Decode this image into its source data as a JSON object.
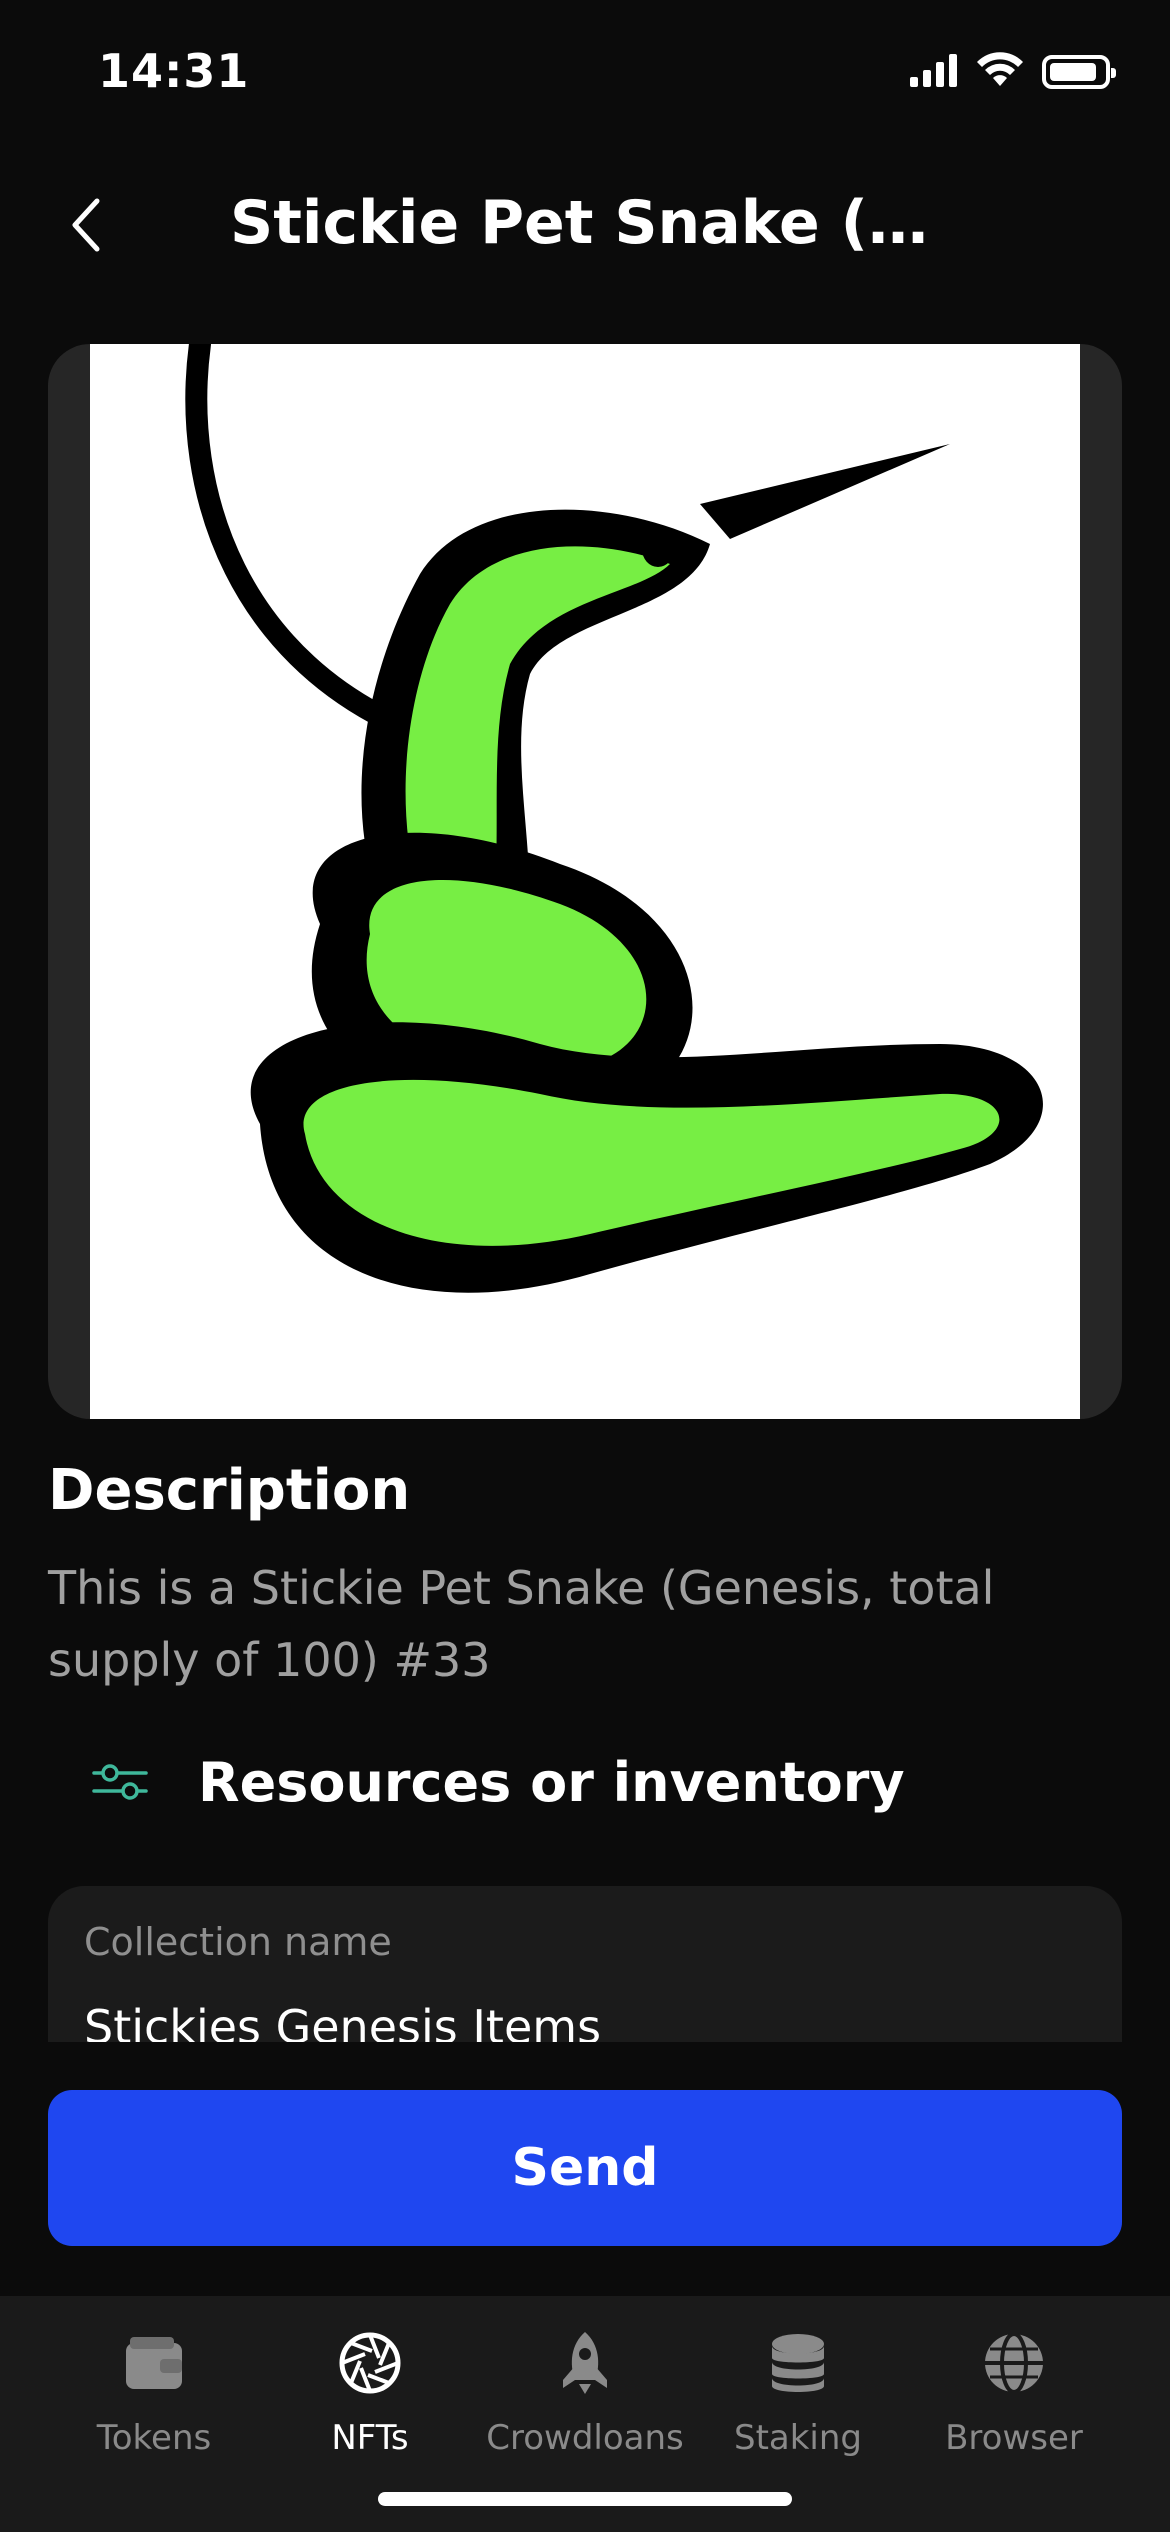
{
  "status_bar": {
    "time": "14:31",
    "icons": [
      "signal-icon",
      "wifi-icon",
      "battery-icon"
    ]
  },
  "header": {
    "title": "Stickie Pet Snake (Gen…",
    "back_icon": "chevron-left-icon"
  },
  "nft": {
    "image": "snake-artwork",
    "colors": {
      "snake_body": "#77ee44",
      "outline": "#000000",
      "background": "#ffffff"
    }
  },
  "description": {
    "title": "Description",
    "text": "This is a Stickie Pet Snake (Genesis, total supply of 100) #33"
  },
  "resources": {
    "icon": "sliders-icon",
    "label": "Resources or inventory"
  },
  "collection": {
    "label": "Collection name",
    "value": "Stickies Genesis Items"
  },
  "send_button": {
    "label": "Send"
  },
  "tabs": [
    {
      "label": "Tokens",
      "icon": "wallet-icon",
      "active": false
    },
    {
      "label": "NFTs",
      "icon": "aperture-icon",
      "active": true
    },
    {
      "label": "Crowdloans",
      "icon": "rocket-icon",
      "active": false
    },
    {
      "label": "Staking",
      "icon": "coins-stack-icon",
      "active": false
    },
    {
      "label": "Browser",
      "icon": "globe-icon",
      "active": false
    }
  ],
  "colors": {
    "background": "#0b0b0b",
    "accent": "#1f47f0",
    "resources_icon": "#3fb89b"
  }
}
